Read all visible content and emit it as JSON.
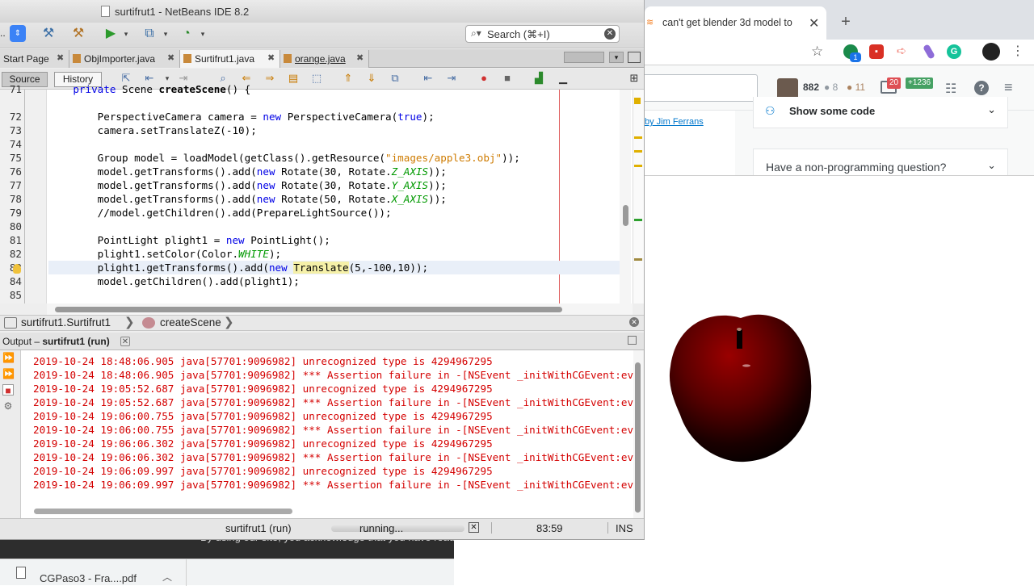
{
  "browser": {
    "tab_title": "can't get blender 3d model to",
    "tab_close": "✕",
    "new_tab": "+",
    "extension_badge": "1",
    "so": {
      "reputation": "882",
      "silver": "● 8",
      "bronze": "● 11",
      "inbox_count": "20",
      "achievements": "+1236",
      "help": "?",
      "left_link": "by  Jim Ferrans",
      "show_code_label": "Show some code",
      "non_programming_label": "Have a non-programming question?"
    },
    "cookie_text": "By using our site, you acknowledge that you have read",
    "download_name": "CGPaso3 - Fra....pdf"
  },
  "netbeans": {
    "window_title": "surtifrut1 - NetBeans IDE 8.2",
    "config_combo": "..",
    "search_placeholder": "Search (⌘+I)",
    "tabs": [
      {
        "label": "Start Page"
      },
      {
        "label": "ObjImporter.java"
      },
      {
        "label": "Surtifrut1.java"
      },
      {
        "label": "orange.java"
      }
    ],
    "source_label": "Source",
    "history_label": "History",
    "code_lines": [
      {
        "n": "71",
        "text": "    private Scene createScene() {"
      },
      {
        "n": "72",
        "text": "        PerspectiveCamera camera = new PerspectiveCamera(true);"
      },
      {
        "n": "73",
        "text": "        camera.setTranslateZ(-10);"
      },
      {
        "n": "74",
        "text": ""
      },
      {
        "n": "75",
        "text": "        Group model = loadModel(getClass().getResource(\"images/apple3.obj\"));"
      },
      {
        "n": "76",
        "text": "        model.getTransforms().add(new Rotate(30, Rotate.Z_AXIS));"
      },
      {
        "n": "77",
        "text": "        model.getTransforms().add(new Rotate(30, Rotate.Y_AXIS));"
      },
      {
        "n": "78",
        "text": "        model.getTransforms().add(new Rotate(50, Rotate.X_AXIS));"
      },
      {
        "n": "79",
        "text": "        //model.getChildren().add(PrepareLightSource());"
      },
      {
        "n": "80",
        "text": ""
      },
      {
        "n": "81",
        "text": "        PointLight plight1 = new PointLight();"
      },
      {
        "n": "82",
        "text": "        plight1.setColor(Color.WHITE);"
      },
      {
        "n": "83",
        "text": "        plight1.getTransforms().add(new Translate(5,-100,10));"
      },
      {
        "n": "84",
        "text": "        model.getChildren().add(plight1);"
      },
      {
        "n": "85",
        "text": ""
      }
    ],
    "breadcrumb": [
      "surtifrut1.Surtifrut1",
      "createScene"
    ],
    "output_title_prefix": "Output – ",
    "output_title": "surtifrut1 (run)",
    "output_lines": [
      "2019-10-24 18:48:06.905 java[57701:9096982] unrecognized type is 4294967295",
      "2019-10-24 18:48:06.905 java[57701:9096982] *** Assertion failure in -[NSEvent _initWithCGEvent:eventRef:]",
      "2019-10-24 19:05:52.687 java[57701:9096982] unrecognized type is 4294967295",
      "2019-10-24 19:05:52.687 java[57701:9096982] *** Assertion failure in -[NSEvent _initWithCGEvent:eventRef:]",
      "2019-10-24 19:06:00.755 java[57701:9096982] unrecognized type is 4294967295",
      "2019-10-24 19:06:00.755 java[57701:9096982] *** Assertion failure in -[NSEvent _initWithCGEvent:eventRef:]",
      "2019-10-24 19:06:06.302 java[57701:9096982] unrecognized type is 4294967295",
      "2019-10-24 19:06:06.302 java[57701:9096982] *** Assertion failure in -[NSEvent _initWithCGEvent:eventRef:]",
      "2019-10-24 19:06:09.997 java[57701:9096982] unrecognized type is 4294967295",
      "2019-10-24 19:06:09.997 java[57701:9096982] *** Assertion failure in -[NSEvent _initWithCGEvent:eventRef:]"
    ],
    "status": {
      "process": "surtifrut1 (run)",
      "running": "running...",
      "position": "83:59",
      "mode": "INS"
    }
  },
  "colors": {
    "output_error": "#d40000",
    "keyword": "#0000e6",
    "string": "#ce7b00",
    "apple": "#7a0000"
  }
}
